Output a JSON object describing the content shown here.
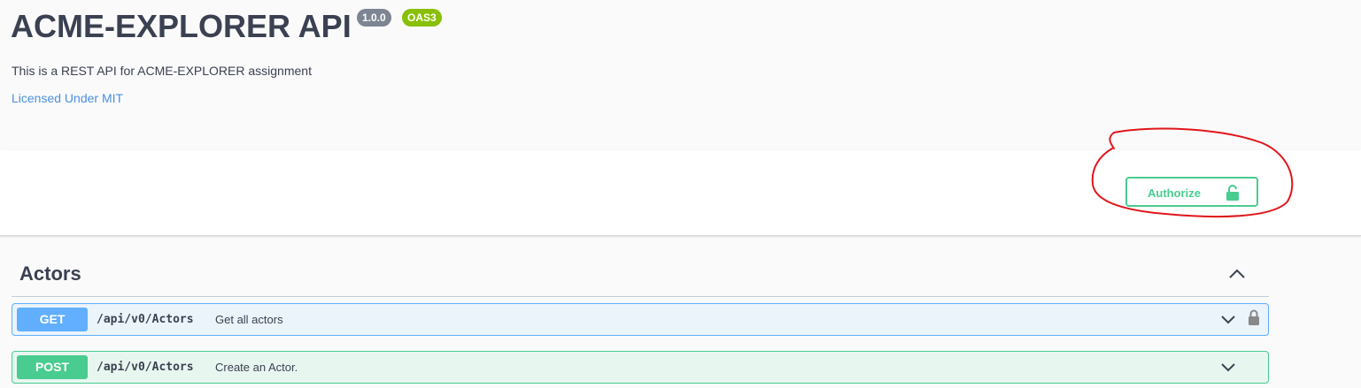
{
  "info": {
    "title": "ACME-EXPLORER API",
    "version": "1.0.0",
    "oas_badge": "OAS3",
    "description": "This is a REST API for ACME-EXPLORER assignment",
    "license": "Licensed Under MIT"
  },
  "auth": {
    "authorize_label": "Authorize",
    "icon": "unlocked-padlock-icon"
  },
  "tag": {
    "name": "Actors",
    "toggle_icon": "chevron-up-icon"
  },
  "operations": [
    {
      "method": "GET",
      "path": "/api/v0/Actors",
      "summary": "Get all actors",
      "color": "#61affe",
      "icons": [
        "chevron-down-icon",
        "lock-icon"
      ]
    },
    {
      "method": "POST",
      "path": "/api/v0/Actors",
      "summary": "Create an Actor.",
      "color": "#49cc90",
      "icons": [
        "chevron-down-icon"
      ]
    }
  ],
  "colors": {
    "get": "#61affe",
    "post": "#49cc90",
    "annotation": "#e0161b",
    "link": "#4990e2"
  }
}
